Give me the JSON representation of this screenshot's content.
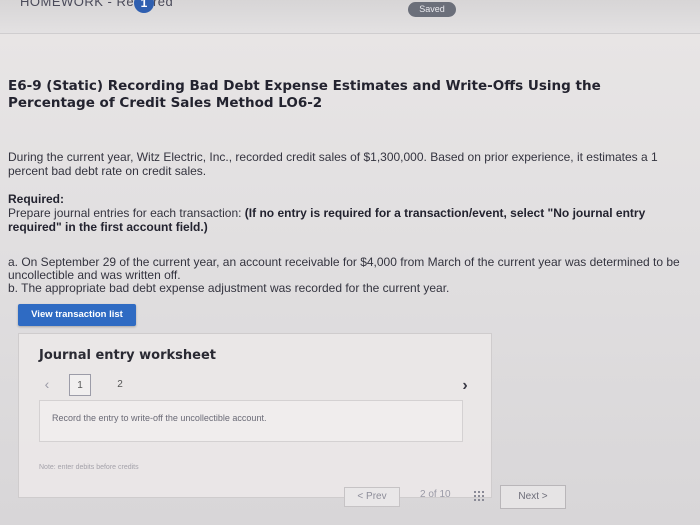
{
  "topbar": {
    "title": "HOMEWORK - Required",
    "badge": "1",
    "saved_label": "Saved"
  },
  "problem": {
    "title": "E6-9 (Static) Recording Bad Debt Expense Estimates and Write-Offs Using the Percentage of Credit Sales Method LO6-2",
    "intro": "During the current year, Witz Electric, Inc., recorded credit sales of $1,300,000. Based on prior experience, it estimates a 1 percent bad debt rate on credit sales.",
    "required_label": "Required:",
    "required_text": "Prepare journal entries for each transaction: ",
    "required_note": "(If no entry is required for a transaction/event, select \"No journal entry required\" in the first account field.)",
    "item_a": "a. On September 29 of the current year, an account receivable for $4,000 from March of the current year was determined to be uncollectible and was written off.",
    "item_b": "b. The appropriate bad debt expense adjustment was recorded for the current year."
  },
  "buttons": {
    "view_transactions": "View transaction list"
  },
  "worksheet": {
    "title": "Journal entry worksheet",
    "pages": [
      "1",
      "2"
    ],
    "active_page": "1",
    "entry_instruction": "Record the entry to write-off the uncollectible account.",
    "note": "Note: enter debits before credits"
  },
  "footer": {
    "prev_label": "< Prev",
    "page_info": "2 of 10",
    "next_label": "Next >"
  },
  "colors": {
    "accent": "#2f6bc3",
    "badge": "#2f5fb0"
  },
  "icons": {
    "prev": "chevron-left-icon",
    "next": "chevron-right-icon",
    "grid": "grid-icon"
  }
}
